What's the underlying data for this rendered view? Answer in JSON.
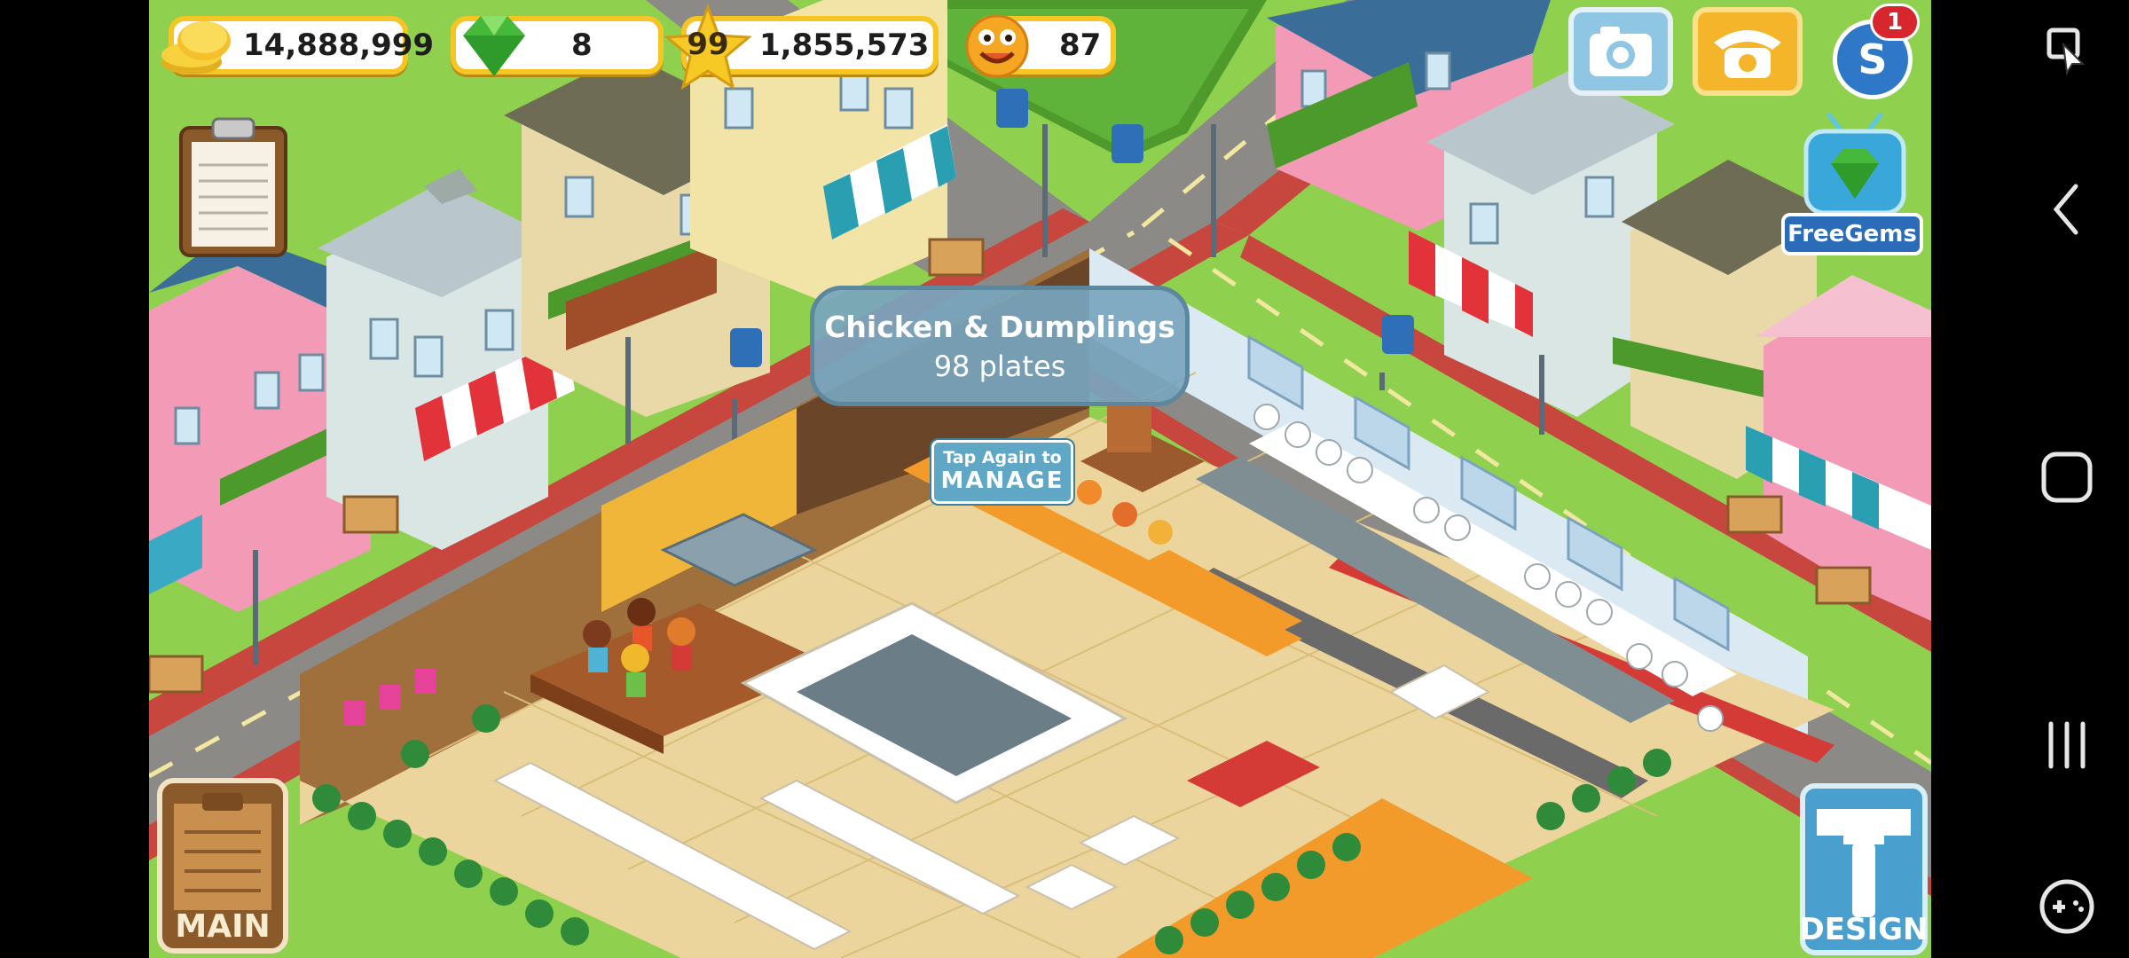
{
  "hud": {
    "coins": "14,888,999",
    "gems": "8",
    "level": "99",
    "xp": "1,855,573",
    "happy": "87",
    "notification_count": "1",
    "free_gems_label": "FreeGems"
  },
  "tooltip": {
    "title": "Chicken & Dumplings",
    "subtitle": "98 plates"
  },
  "manage": {
    "line1": "Tap Again to",
    "line2": "MANAGE"
  },
  "buttons": {
    "main_label": "MAIN",
    "design_label": "DESIGN"
  },
  "colors": {
    "grass": "#8fd14f",
    "road": "#8b8a86",
    "sidewalk": "#c7473f",
    "floor": "#ecd59d",
    "hud_border": "#f5c523",
    "tooltip_bg": "#78a5be"
  },
  "icons": {
    "coins": "coin-stack-icon",
    "gems": "green-gem-icon",
    "level": "star-icon",
    "happy": "smiley-face-icon",
    "camera": "camera-icon",
    "phone": "telephone-icon",
    "social": "social-s-icon",
    "free_gems": "tv-gem-icon",
    "main": "clipboard-icon",
    "design": "hammer-icon",
    "orders": "clipboard-notes-icon"
  },
  "nav": {
    "items": [
      "screen-mirror-icon",
      "back-icon",
      "home-icon",
      "recents-icon",
      "gamepad-icon"
    ]
  }
}
